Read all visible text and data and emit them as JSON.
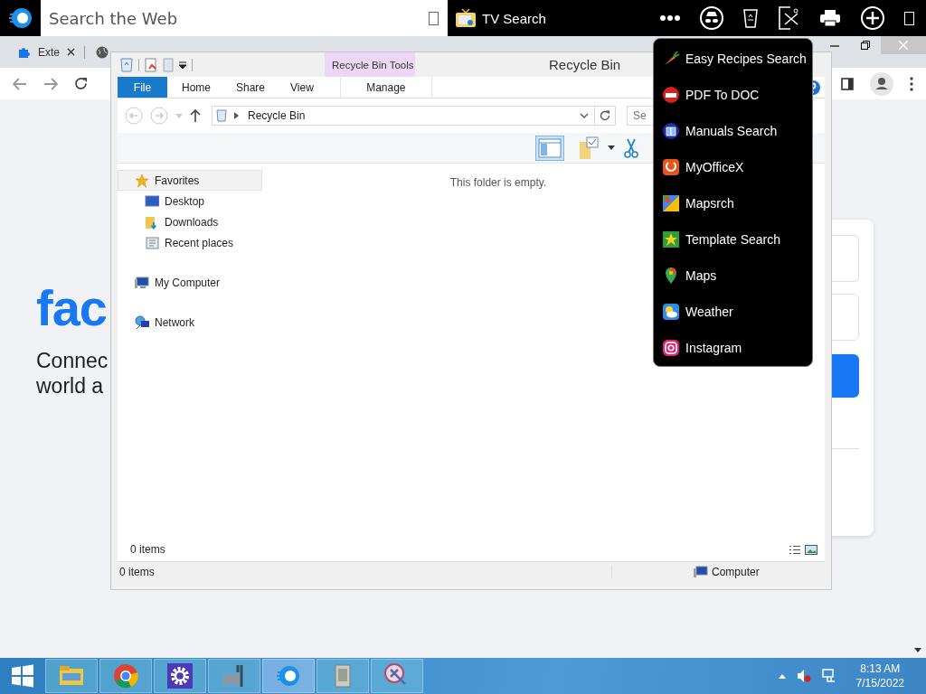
{
  "top_bar": {
    "search_placeholder": "Search the Web",
    "title": "TV Search"
  },
  "browser": {
    "tabs": [
      {
        "label": "Exte"
      }
    ],
    "page": {
      "logo": "fac",
      "tagline": [
        "Connec",
        "world a"
      ]
    }
  },
  "explorer": {
    "title": "Recycle Bin",
    "context_tab": "Recycle Bin Tools",
    "ribbon_tabs": [
      {
        "label": "File",
        "kind": "file"
      },
      {
        "label": "Home",
        "kind": "tab"
      },
      {
        "label": "Share",
        "kind": "tab"
      },
      {
        "label": "View",
        "kind": "tab"
      },
      {
        "label": "Manage",
        "kind": "context"
      }
    ],
    "address": "Recycle Bin",
    "search_placeholder": "Se",
    "nav": [
      {
        "label": "Favorites",
        "selected": true,
        "children": [
          {
            "label": "Desktop",
            "selected": false
          },
          {
            "label": "Downloads",
            "selected": false
          },
          {
            "label": "Recent places",
            "selected": false
          }
        ]
      },
      {
        "label": "My Computer",
        "selected": false
      },
      {
        "label": "Network",
        "selected": false
      }
    ],
    "empty_message": "This folder is empty.",
    "item_count": "0 items",
    "status": {
      "items": "0 items",
      "location": "Computer"
    }
  },
  "menu": [
    {
      "label": "Easy Recipes Search"
    },
    {
      "label": "PDF To DOC"
    },
    {
      "label": "Manuals Search"
    },
    {
      "label": "MyOfficeX"
    },
    {
      "label": "Mapsrch"
    },
    {
      "label": "Template Search"
    },
    {
      "label": "Maps"
    },
    {
      "label": "Weather"
    },
    {
      "label": "Instagram"
    }
  ],
  "taskbar": {
    "time": "8:13 AM",
    "date": "7/15/2022"
  }
}
